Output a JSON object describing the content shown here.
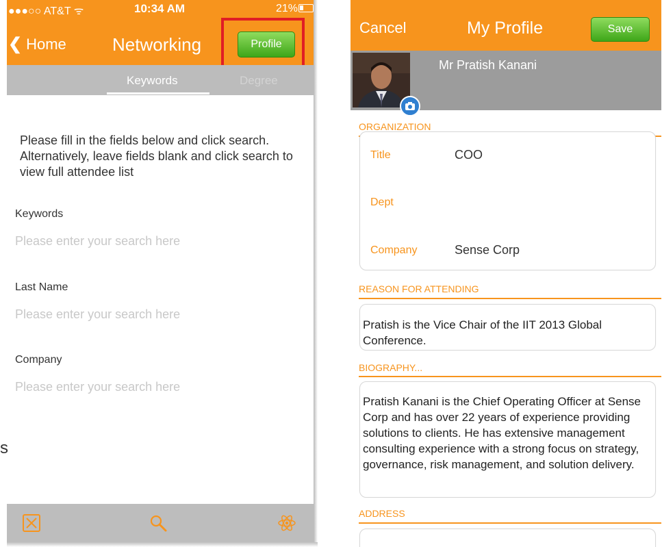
{
  "left": {
    "status": {
      "carrier": "●●●○○ AT&T ᯤ",
      "time": "10:34 AM",
      "battery": "21%"
    },
    "header": {
      "back_label": "Home",
      "title": "Networking",
      "profile_label": "Profile"
    },
    "segments": {
      "keywords": "Keywords",
      "degree": "Degree"
    },
    "intro": "Please fill in the fields below and click search. Alternatively, leave fields blank and click search to view full attendee list",
    "fields": [
      {
        "label": "Keywords",
        "placeholder": "Please enter your search here"
      },
      {
        "label": "Last Name",
        "placeholder": "Please enter your search here"
      },
      {
        "label": "Company",
        "placeholder": "Please enter your search here"
      }
    ],
    "stray_text": "s",
    "tabbar": {
      "icons": [
        "close-box-icon",
        "search-icon",
        "atom-icon"
      ]
    }
  },
  "right": {
    "header": {
      "cancel_label": "Cancel",
      "title": "My Profile",
      "save_label": "Save"
    },
    "name": "Mr Pratish Kanani",
    "organization": {
      "section_title": "ORGANIZATION",
      "fields": [
        {
          "label": "Title",
          "value": "COO"
        },
        {
          "label": "Dept",
          "value": ""
        },
        {
          "label": "Company",
          "value": "Sense Corp"
        }
      ]
    },
    "reason": {
      "section_title": "REASON FOR ATTENDING",
      "text": "Pratish is the Vice Chair of the IIT 2013 Global Conference."
    },
    "biography": {
      "section_title": "BIOGRAPHY...",
      "text": "Pratish Kanani is the Chief Operating Officer at Sense Corp and has over 22 years of experience providing solutions to clients.  He has extensive management consulting experience with a strong focus on strategy, governance, risk management, and solution delivery."
    },
    "address": {
      "section_title": "ADDRESS"
    }
  },
  "colors": {
    "accent": "#f7941d",
    "button_green": "#3ea619",
    "highlight_red": "#e01d25",
    "band_gray": "#9c9c9c"
  }
}
